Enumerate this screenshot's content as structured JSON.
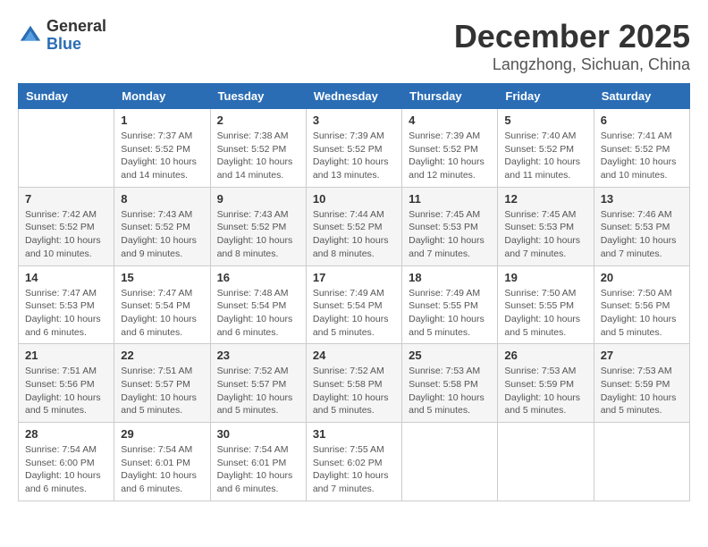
{
  "header": {
    "logo_general": "General",
    "logo_blue": "Blue",
    "month_title": "December 2025",
    "location": "Langzhong, Sichuan, China"
  },
  "days_of_week": [
    "Sunday",
    "Monday",
    "Tuesday",
    "Wednesday",
    "Thursday",
    "Friday",
    "Saturday"
  ],
  "weeks": [
    [
      {
        "day": "",
        "info": ""
      },
      {
        "day": "1",
        "info": "Sunrise: 7:37 AM\nSunset: 5:52 PM\nDaylight: 10 hours\nand 14 minutes."
      },
      {
        "day": "2",
        "info": "Sunrise: 7:38 AM\nSunset: 5:52 PM\nDaylight: 10 hours\nand 14 minutes."
      },
      {
        "day": "3",
        "info": "Sunrise: 7:39 AM\nSunset: 5:52 PM\nDaylight: 10 hours\nand 13 minutes."
      },
      {
        "day": "4",
        "info": "Sunrise: 7:39 AM\nSunset: 5:52 PM\nDaylight: 10 hours\nand 12 minutes."
      },
      {
        "day": "5",
        "info": "Sunrise: 7:40 AM\nSunset: 5:52 PM\nDaylight: 10 hours\nand 11 minutes."
      },
      {
        "day": "6",
        "info": "Sunrise: 7:41 AM\nSunset: 5:52 PM\nDaylight: 10 hours\nand 10 minutes."
      }
    ],
    [
      {
        "day": "7",
        "info": "Sunrise: 7:42 AM\nSunset: 5:52 PM\nDaylight: 10 hours\nand 10 minutes."
      },
      {
        "day": "8",
        "info": "Sunrise: 7:43 AM\nSunset: 5:52 PM\nDaylight: 10 hours\nand 9 minutes."
      },
      {
        "day": "9",
        "info": "Sunrise: 7:43 AM\nSunset: 5:52 PM\nDaylight: 10 hours\nand 8 minutes."
      },
      {
        "day": "10",
        "info": "Sunrise: 7:44 AM\nSunset: 5:52 PM\nDaylight: 10 hours\nand 8 minutes."
      },
      {
        "day": "11",
        "info": "Sunrise: 7:45 AM\nSunset: 5:53 PM\nDaylight: 10 hours\nand 7 minutes."
      },
      {
        "day": "12",
        "info": "Sunrise: 7:45 AM\nSunset: 5:53 PM\nDaylight: 10 hours\nand 7 minutes."
      },
      {
        "day": "13",
        "info": "Sunrise: 7:46 AM\nSunset: 5:53 PM\nDaylight: 10 hours\nand 7 minutes."
      }
    ],
    [
      {
        "day": "14",
        "info": "Sunrise: 7:47 AM\nSunset: 5:53 PM\nDaylight: 10 hours\nand 6 minutes."
      },
      {
        "day": "15",
        "info": "Sunrise: 7:47 AM\nSunset: 5:54 PM\nDaylight: 10 hours\nand 6 minutes."
      },
      {
        "day": "16",
        "info": "Sunrise: 7:48 AM\nSunset: 5:54 PM\nDaylight: 10 hours\nand 6 minutes."
      },
      {
        "day": "17",
        "info": "Sunrise: 7:49 AM\nSunset: 5:54 PM\nDaylight: 10 hours\nand 5 minutes."
      },
      {
        "day": "18",
        "info": "Sunrise: 7:49 AM\nSunset: 5:55 PM\nDaylight: 10 hours\nand 5 minutes."
      },
      {
        "day": "19",
        "info": "Sunrise: 7:50 AM\nSunset: 5:55 PM\nDaylight: 10 hours\nand 5 minutes."
      },
      {
        "day": "20",
        "info": "Sunrise: 7:50 AM\nSunset: 5:56 PM\nDaylight: 10 hours\nand 5 minutes."
      }
    ],
    [
      {
        "day": "21",
        "info": "Sunrise: 7:51 AM\nSunset: 5:56 PM\nDaylight: 10 hours\nand 5 minutes."
      },
      {
        "day": "22",
        "info": "Sunrise: 7:51 AM\nSunset: 5:57 PM\nDaylight: 10 hours\nand 5 minutes."
      },
      {
        "day": "23",
        "info": "Sunrise: 7:52 AM\nSunset: 5:57 PM\nDaylight: 10 hours\nand 5 minutes."
      },
      {
        "day": "24",
        "info": "Sunrise: 7:52 AM\nSunset: 5:58 PM\nDaylight: 10 hours\nand 5 minutes."
      },
      {
        "day": "25",
        "info": "Sunrise: 7:53 AM\nSunset: 5:58 PM\nDaylight: 10 hours\nand 5 minutes."
      },
      {
        "day": "26",
        "info": "Sunrise: 7:53 AM\nSunset: 5:59 PM\nDaylight: 10 hours\nand 5 minutes."
      },
      {
        "day": "27",
        "info": "Sunrise: 7:53 AM\nSunset: 5:59 PM\nDaylight: 10 hours\nand 5 minutes."
      }
    ],
    [
      {
        "day": "28",
        "info": "Sunrise: 7:54 AM\nSunset: 6:00 PM\nDaylight: 10 hours\nand 6 minutes."
      },
      {
        "day": "29",
        "info": "Sunrise: 7:54 AM\nSunset: 6:01 PM\nDaylight: 10 hours\nand 6 minutes."
      },
      {
        "day": "30",
        "info": "Sunrise: 7:54 AM\nSunset: 6:01 PM\nDaylight: 10 hours\nand 6 minutes."
      },
      {
        "day": "31",
        "info": "Sunrise: 7:55 AM\nSunset: 6:02 PM\nDaylight: 10 hours\nand 7 minutes."
      },
      {
        "day": "",
        "info": ""
      },
      {
        "day": "",
        "info": ""
      },
      {
        "day": "",
        "info": ""
      }
    ]
  ]
}
